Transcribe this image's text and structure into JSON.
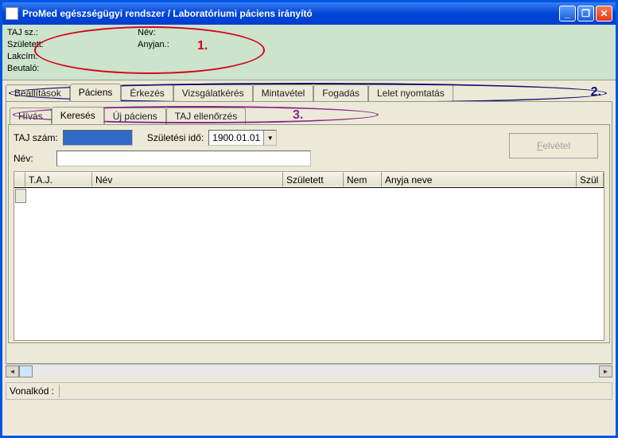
{
  "window": {
    "title": "ProMed egészségügyi rendszer / Laboratóriumi páciens irányító"
  },
  "patient": {
    "taj_label": "TAJ sz.:",
    "nev_label": "Név:",
    "szuletett_label": "Született:",
    "anyjan_label": "Anyjan.:",
    "lakcim_label": "Lakcím:",
    "beutalo_label": "Beutaló:"
  },
  "tabs_main": {
    "beallitasok": "Beállítások",
    "paciens": "Páciens",
    "erkezes": "Érkezés",
    "vizsgalatkeres": "Vizsgálatkérés",
    "mintavetel": "Mintavétel",
    "fogadas": "Fogadás",
    "lelet": "Lelet nyomtatás"
  },
  "tabs_sub": {
    "hivas": "Hívás",
    "kereses": "Keresés",
    "ujpaciens": "Új páciens",
    "tajell": "TAJ ellenőrzés"
  },
  "form": {
    "taj_label": "TAJ szám:",
    "szulido_label": "Születési idő:",
    "szulido_value": "1900.01.01",
    "nev_label": "Név:",
    "felvetel_label": "Felvétel"
  },
  "grid": {
    "col_taj": "T.A.J.",
    "col_nev": "Név",
    "col_szuletett": "Született",
    "col_nem": "Nem",
    "col_anyja": "Anyja neve",
    "col_szul2": "Szül"
  },
  "status": {
    "vonalkod_label": "Vonalkód :"
  },
  "annotations": {
    "n1": "1.",
    "n2": "2.",
    "n3": "3."
  }
}
